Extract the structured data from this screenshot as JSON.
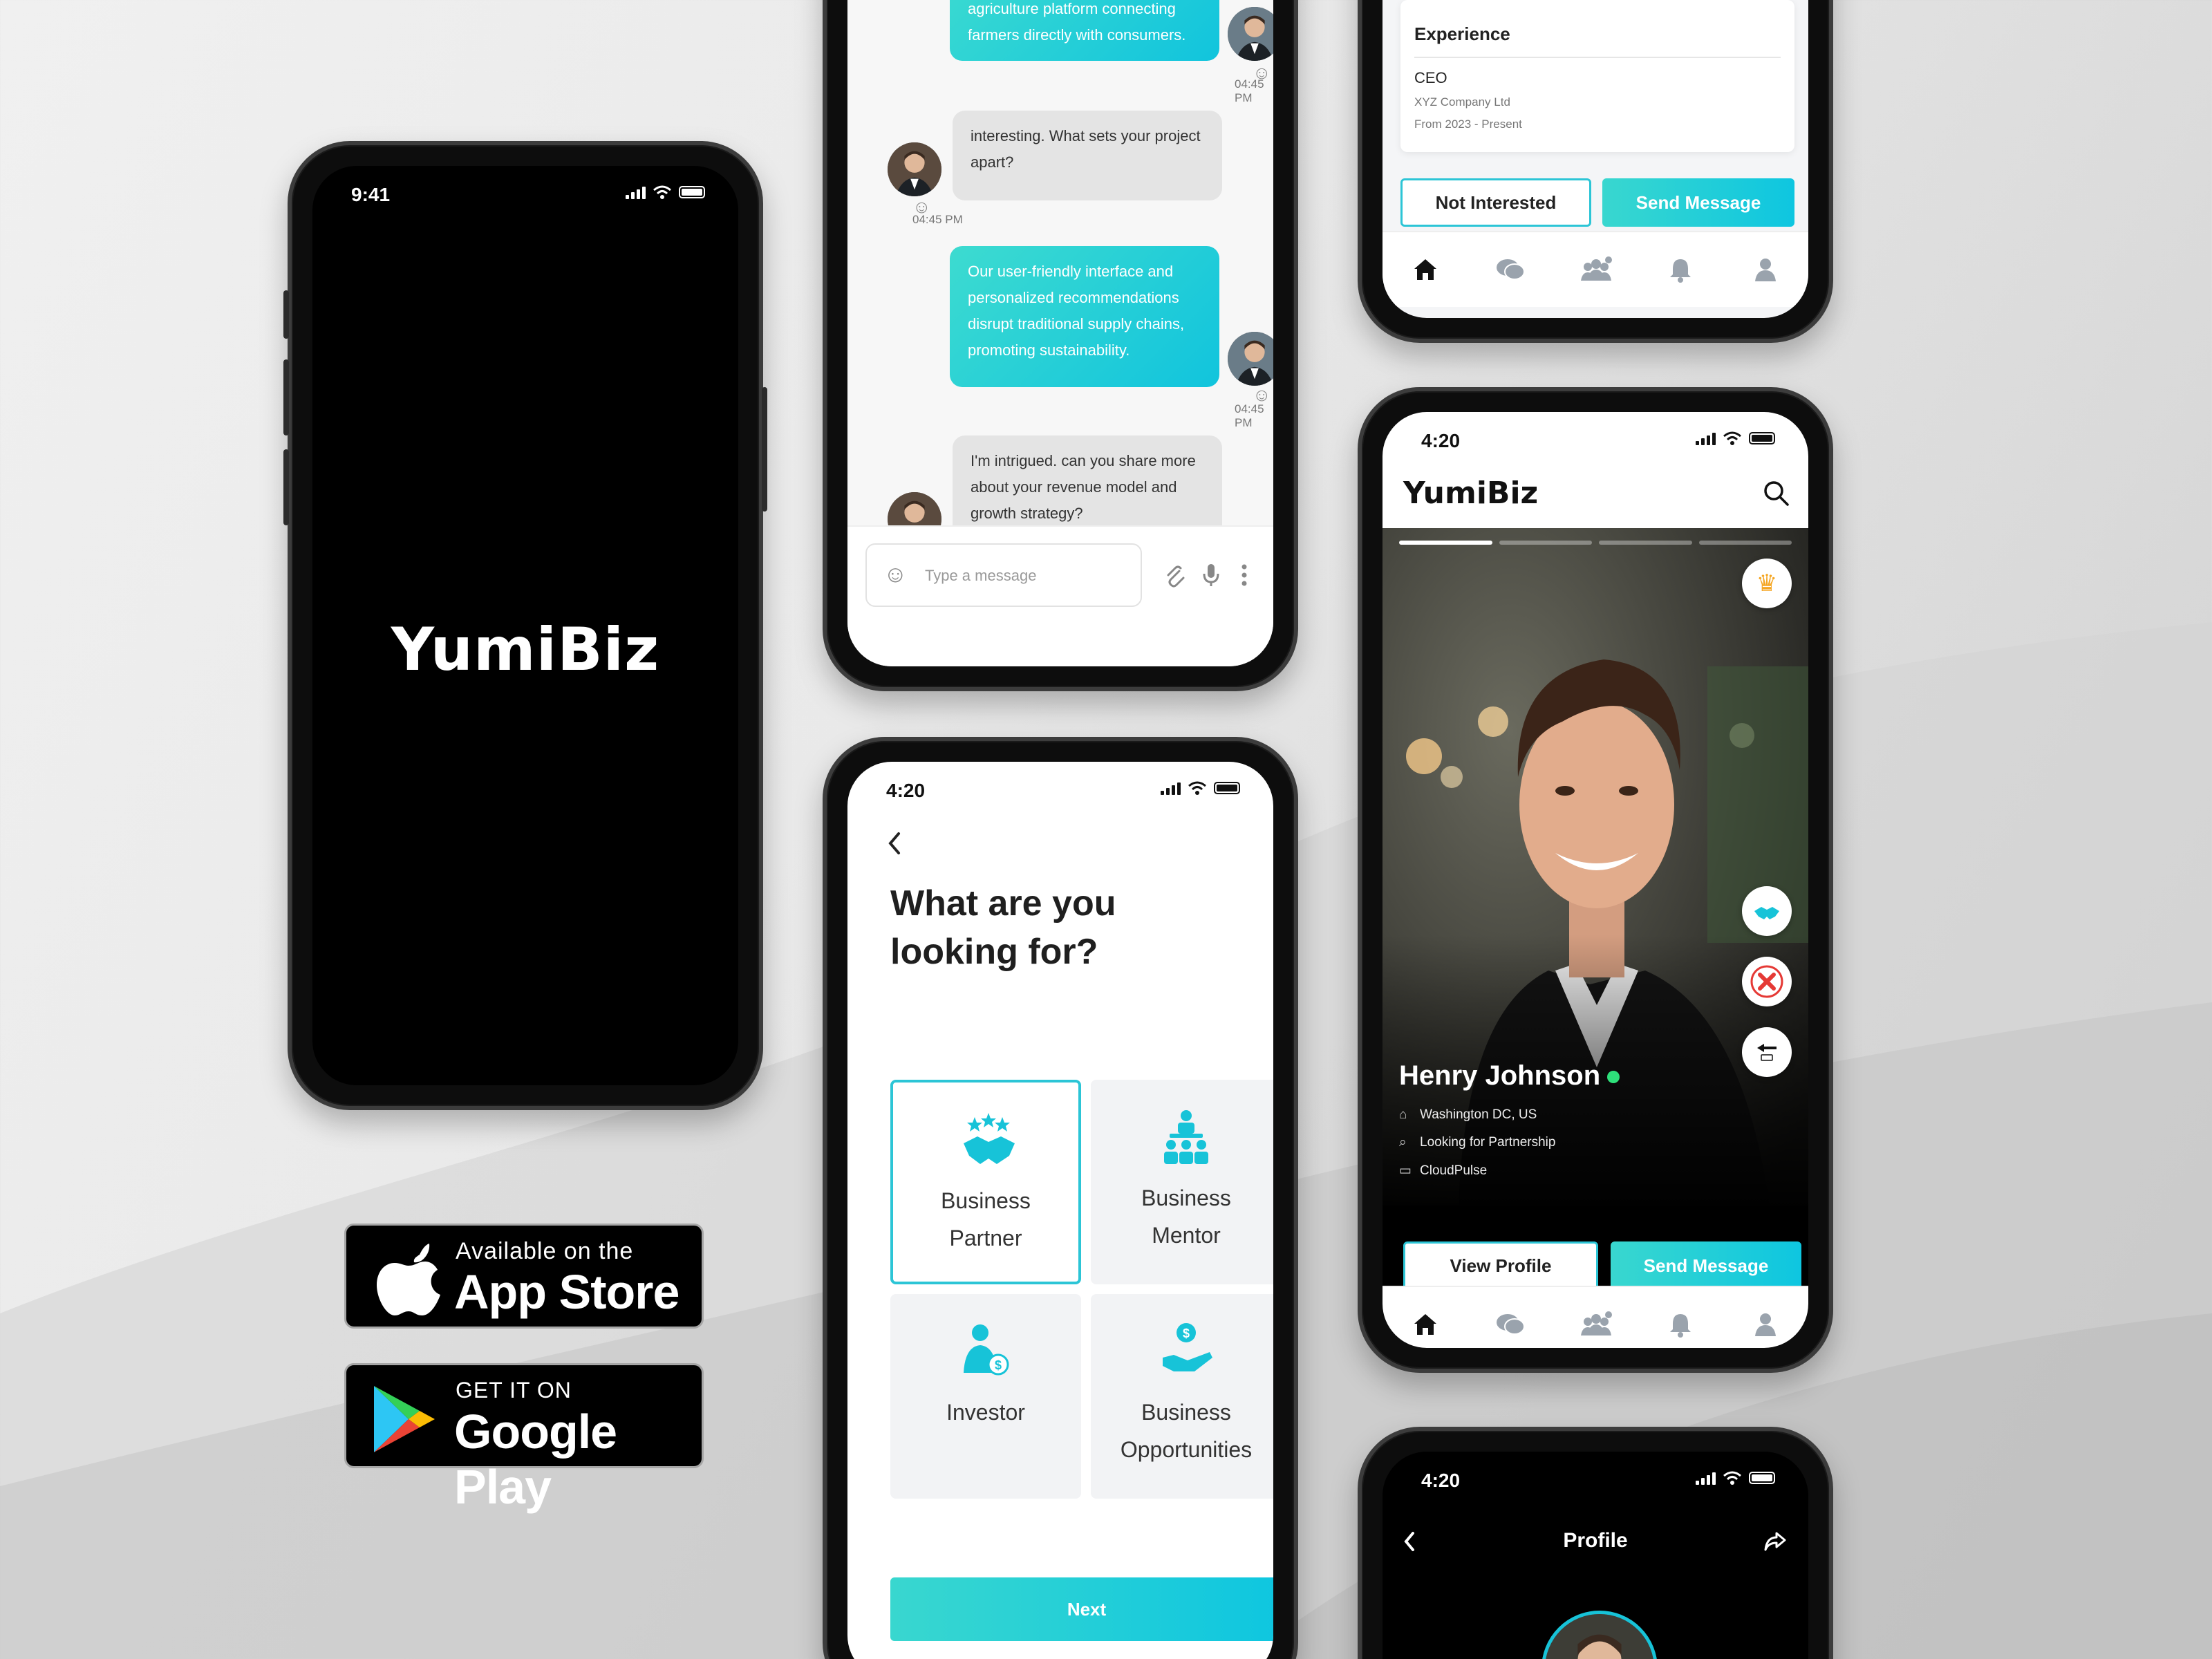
{
  "splash": {
    "time": "9:41",
    "logo": "YumiBiz"
  },
  "chat": {
    "messages": [
      {
        "text": "agriculture platform connecting farmers directly with consumers.",
        "from": "me"
      },
      {
        "time": "04:45 PM"
      },
      {
        "text": "interesting. What sets your project apart?",
        "from": "them"
      },
      {
        "time": "04:45 PM"
      },
      {
        "text": "Our user-friendly interface and personalized recommendations disrupt traditional supply chains, promoting sustainability.",
        "from": "me"
      },
      {
        "time": "04:45 PM"
      },
      {
        "text": "I'm intrigued. can you share more about your revenue model and growth strategy?",
        "from": "them"
      }
    ],
    "input_placeholder": "Type a message"
  },
  "looking_for": {
    "time": "4:20",
    "title": "What are you looking for?",
    "options": [
      {
        "label": "Business Partner",
        "icon": "handshake-stars-icon",
        "selected": true
      },
      {
        "label": "Business Mentor",
        "icon": "mentor-group-icon",
        "selected": false
      },
      {
        "label": "Investor",
        "icon": "investor-icon",
        "selected": false
      },
      {
        "label": "Business Opportunities",
        "icon": "hand-coin-icon",
        "selected": false
      }
    ],
    "next_label": "Next"
  },
  "experience": {
    "title": "Experience",
    "role": "CEO",
    "company": "XYZ Company Ltd",
    "dates": "From 2023 - Present",
    "not_interested_label": "Not Interested",
    "send_message_label": "Send Message"
  },
  "discover": {
    "time": "4:20",
    "logo": "YumiBiz",
    "name": "Henry Johnson",
    "location": "Washington DC, US",
    "looking": "Looking for Partnership",
    "company": "CloudPulse",
    "view_profile_label": "View Profile",
    "send_message_label": "Send Message"
  },
  "profile": {
    "time": "4:20",
    "title": "Profile"
  },
  "stores": {
    "apple_line1": "Available on the",
    "apple_line2": "App Store",
    "google_line1": "GET IT ON",
    "google_line2": "Google Play"
  },
  "colors": {
    "accent": "#15C7DC",
    "accent_light": "#3DDBD0",
    "online": "#2EE07A",
    "decline": "#E53935"
  },
  "tabbar_icons": [
    "home-icon",
    "chat-icon",
    "people-icon",
    "bell-icon",
    "user-icon"
  ]
}
